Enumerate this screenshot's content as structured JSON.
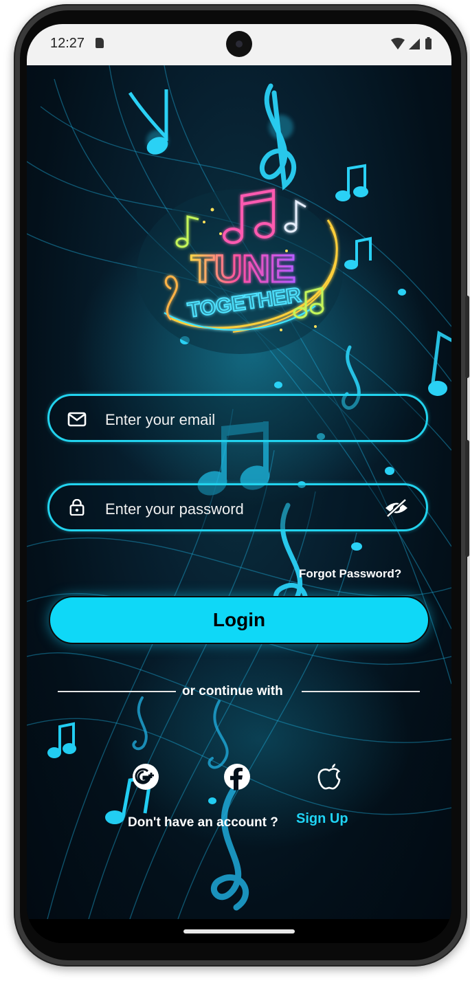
{
  "status_bar": {
    "time": "12:27"
  },
  "app": {
    "logo": {
      "line1": "TUNE",
      "line2": "TOGETHER"
    },
    "email": {
      "placeholder": "Enter your email"
    },
    "password": {
      "placeholder": "Enter your password"
    },
    "forgot_label": "Forgot Password?",
    "login_label": "Login",
    "divider_label": "or continue with",
    "social": [
      {
        "name": "google",
        "icon": "google-plus-icon"
      },
      {
        "name": "facebook",
        "icon": "facebook-icon"
      },
      {
        "name": "apple",
        "icon": "apple-icon"
      }
    ],
    "signup_prompt": "Don't have an account ?",
    "signup_link": "Sign Up"
  },
  "colors": {
    "accent": "#0fd8f7",
    "background": "#03101a",
    "text": "#ffffff",
    "link": "#20d4f5"
  }
}
